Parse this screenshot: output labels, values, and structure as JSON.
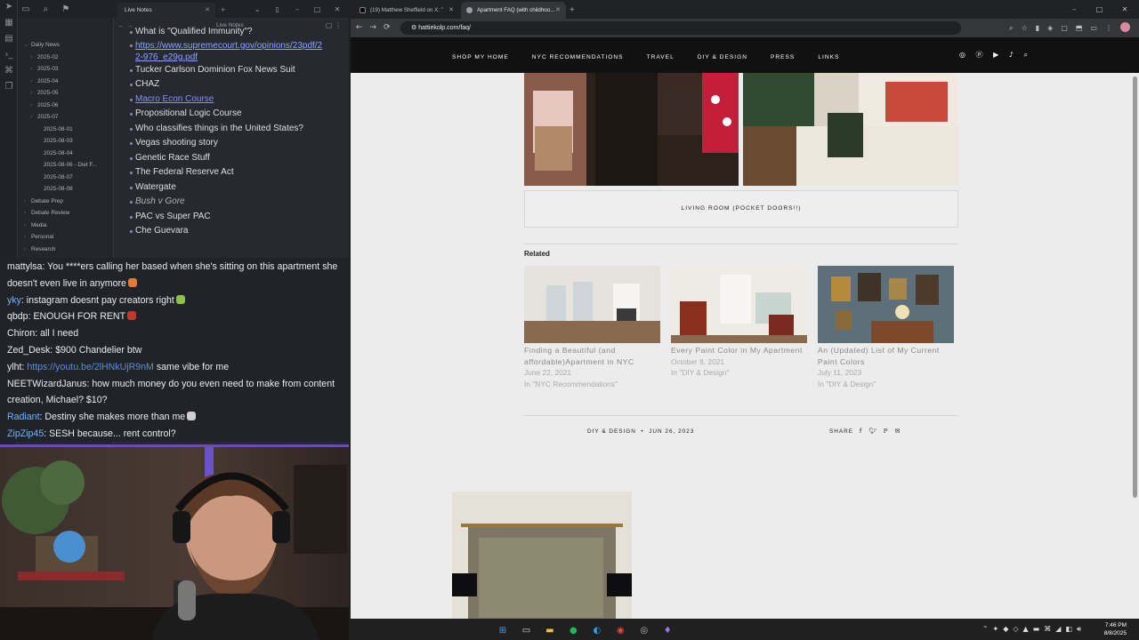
{
  "notes_app": {
    "tab_title": "Live Notes",
    "header_title": "Live Notes",
    "tree": [
      {
        "label": "Daily News",
        "caret": "v",
        "indent": 1
      },
      {
        "label": "2025-02",
        "caret": ">",
        "indent": 2
      },
      {
        "label": "2025-03",
        "caret": ">",
        "indent": 2
      },
      {
        "label": "2025-04",
        "caret": ">",
        "indent": 2
      },
      {
        "label": "2025-05",
        "caret": ">",
        "indent": 2
      },
      {
        "label": "2025-06",
        "caret": ">",
        "indent": 2
      },
      {
        "label": "2025-07",
        "caret": ">",
        "indent": 2
      },
      {
        "label": "2025-08-01",
        "caret": "",
        "indent": 3
      },
      {
        "label": "2025-08-03",
        "caret": "",
        "indent": 3
      },
      {
        "label": "2025-08-04",
        "caret": "",
        "indent": 3
      },
      {
        "label": "2025-08-06 - Diet F...",
        "caret": "",
        "indent": 3
      },
      {
        "label": "2025-08-07",
        "caret": "",
        "indent": 3
      },
      {
        "label": "2025-08-08",
        "caret": "",
        "indent": 3
      },
      {
        "label": "Debate Prep",
        "caret": ">",
        "indent": 1
      },
      {
        "label": "Debate Review",
        "caret": ">",
        "indent": 1
      },
      {
        "label": "Media",
        "caret": ">",
        "indent": 1
      },
      {
        "label": "Personal",
        "caret": ">",
        "indent": 1
      },
      {
        "label": "Research",
        "caret": ">",
        "indent": 1
      }
    ],
    "bullets": [
      {
        "text": "What is \"Qualified Immunity\"?",
        "style": "normal"
      },
      {
        "text": "https://www.supremecourt.gov/opinions/23pdf/22-976_e29g.pdf",
        "style": "link"
      },
      {
        "text": "Tucker Carlson Dominion Fox News Suit",
        "style": "normal"
      },
      {
        "text": "CHAZ",
        "style": "normal"
      },
      {
        "text": "Macro Econ Course",
        "style": "intlink"
      },
      {
        "text": "Propositional Logic Course",
        "style": "normal"
      },
      {
        "text": "Who classifies things in the United States?",
        "style": "normal"
      },
      {
        "text": "Vegas shooting story",
        "style": "normal"
      },
      {
        "text": "Genetic Race Stuff",
        "style": "normal"
      },
      {
        "text": "The Federal Reserve Act",
        "style": "normal"
      },
      {
        "text": "Watergate",
        "style": "normal"
      },
      {
        "text": "Bush v Gore",
        "style": "italic"
      },
      {
        "text": "PAC vs Super PAC",
        "style": "normal"
      },
      {
        "text": "Che Guevara",
        "style": "normal"
      }
    ]
  },
  "chat": [
    {
      "user": "mattylsa",
      "msg": "You ****ers calling her based when she's sitting on this apartment she doesn't even live in anymore",
      "user_color": "white",
      "emote": "#e07a3a"
    },
    {
      "user": "yky",
      "msg": "instagram doesnt pay creators right",
      "user_color": "blue",
      "emote": "#8bc34a"
    },
    {
      "user": "qbdp",
      "msg": "ENOUGH FOR RENT",
      "user_color": "white",
      "emote": "#c0392b"
    },
    {
      "user": "Chiron",
      "msg": "all I need",
      "user_color": "white",
      "emote": ""
    },
    {
      "user": "Zed_Desk",
      "msg": "$900 Chandelier btw",
      "user_color": "white",
      "emote": ""
    },
    {
      "user": "ylht",
      "msg": "same vibe for me",
      "url": "https://youtu.be/2lHNkUjR9nM",
      "user_color": "white",
      "emote": ""
    },
    {
      "user": "NEETWizardJanus",
      "msg": "how much money do you even need to make from content creation, Michael? $10?",
      "user_color": "white",
      "emote": ""
    },
    {
      "user": "Radiant",
      "msg": "Destiny she makes more than me",
      "user_color": "blue",
      "emote": "#cfcfcf"
    },
    {
      "user": "ZipZip45",
      "msg": "SESH because... rent control?",
      "user_color": "blue",
      "emote": ""
    }
  ],
  "browser": {
    "tabs": [
      {
        "title": "(19) Matthew Sheffield on X: \"",
        "active": false,
        "fav_color": "#000000"
      },
      {
        "title": "Apartment FAQ (with childhoo...",
        "active": true,
        "fav_color": "#9aa0a6"
      }
    ],
    "url": "hattiekolp.com/faq/",
    "site_nav": [
      "SHOP MY HOME",
      "NYC RECOMMENDATIONS",
      "TRAVEL",
      "DIY & DESIGN",
      "PRESS",
      "LINKS"
    ],
    "caption": "LIVING ROOM (POCKET DOORS!!)",
    "related_label": "Related",
    "related": [
      {
        "title": "Finding a Beautiful (and affordable)Apartment in NYC",
        "date": "June 22, 2021",
        "category": "In \"NYC Recommendations\""
      },
      {
        "title": "Every Paint Color in My Apartment",
        "date": "October 8, 2021",
        "category": "In \"DIY & Design\""
      },
      {
        "title": "An (Updated) List of My Current Paint Colors",
        "date": "July 11, 2023",
        "category": "In \"DIY & Design\""
      }
    ],
    "post_meta": {
      "category": "DIY & DESIGN",
      "date": "JUN 26, 2023"
    },
    "share_label": "SHARE"
  },
  "taskbar": {
    "time": "7:46 PM",
    "date": "8/8/2025"
  }
}
